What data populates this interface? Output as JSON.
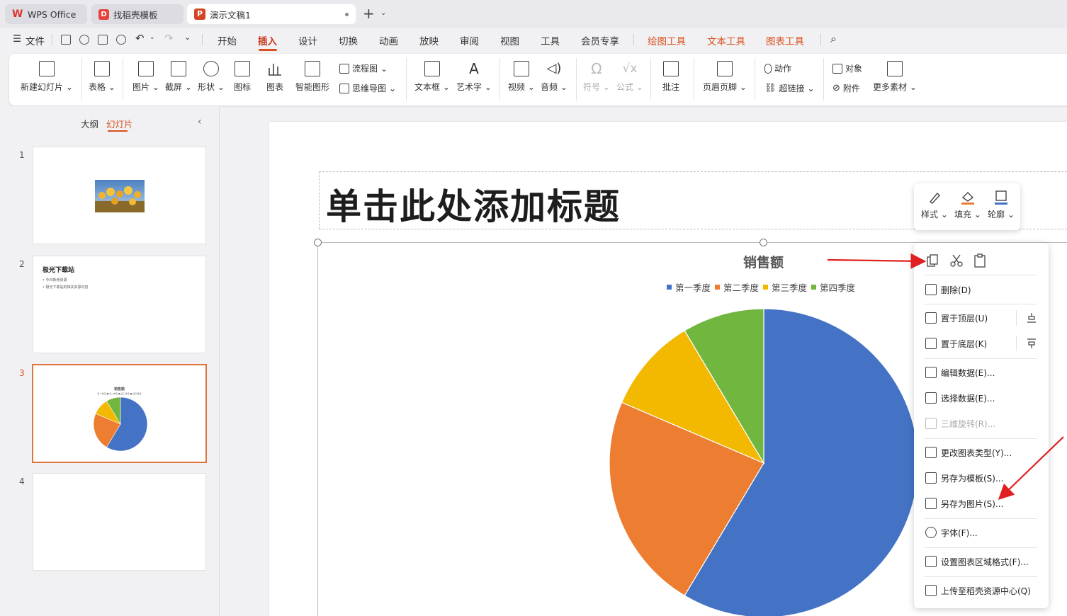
{
  "tabs": [
    {
      "label": "WPS Office",
      "icon": "wps-logo-icon"
    },
    {
      "label": "找稻壳模板",
      "icon": "docer-logo-icon"
    },
    {
      "label": "演示文稿1",
      "icon": "presentation-logo-icon"
    }
  ],
  "menu": {
    "file": "文件",
    "items": [
      "开始",
      "插入",
      "设计",
      "切换",
      "动画",
      "放映",
      "审阅",
      "视图",
      "工具",
      "会员专享"
    ],
    "context_items": [
      "绘图工具",
      "文本工具",
      "图表工具"
    ],
    "active": "插入"
  },
  "ribbon": {
    "new_slide": "新建幻灯片",
    "table": "表格",
    "picture": "图片",
    "screenshot": "截屏",
    "shape": "形状",
    "icon": "图标",
    "chart": "图表",
    "smartart": "智能图形",
    "flowchart": "流程图",
    "mindmap": "思维导图",
    "textbox": "文本框",
    "wordart": "艺术字",
    "video": "视频",
    "audio": "音频",
    "symbol": "符号",
    "formula": "公式",
    "comment": "批注",
    "header_footer": "页眉页脚",
    "action": "动作",
    "hyperlink": "超链接",
    "object": "对象",
    "attachment": "附件",
    "more_assets": "更多素材"
  },
  "left_panel": {
    "tab_outline": "大纲",
    "tab_slides": "幻灯片",
    "slides": [
      {
        "number": "1"
      },
      {
        "number": "2",
        "title": "极光下载站",
        "bullets": [
          "• 今日新增资源",
          "• 极光下载站的相关资源内容"
        ]
      },
      {
        "number": "3",
        "mini_title": "销售额",
        "mini_legend": "第一季度 ■ 第二季度 ■ 第三季度 ■ 第四季度"
      },
      {
        "number": "4"
      }
    ]
  },
  "slide": {
    "title_placeholder": "单击此处添加标题"
  },
  "mini_toolbar": {
    "style": "样式",
    "fill": "填充",
    "outline": "轮廓"
  },
  "context_menu": {
    "delete": "删除(D)",
    "bring_to_front": "置于顶层(U)",
    "send_to_back": "置于底层(K)",
    "edit_data": "编辑数据(E)...",
    "select_data": "选择数据(E)...",
    "rotate_3d": "三维旋转(R)...",
    "change_chart_type": "更改图表类型(Y)...",
    "save_as_template": "另存为模板(S)...",
    "save_as_picture": "另存为图片(S)...",
    "font": "字体(F)...",
    "format_chart_area": "设置图表区域格式(F)...",
    "upload": "上传至稻壳资源中心(Q)"
  },
  "colors": {
    "accent": "#d9501f",
    "series": [
      "#4472c4",
      "#ed7d31",
      "#f2b900",
      "#70b63f"
    ]
  },
  "chart_data": {
    "type": "pie",
    "title": "销售额",
    "categories": [
      "第一季度",
      "第二季度",
      "第三季度",
      "第四季度"
    ],
    "values": [
      8.2,
      3.2,
      1.4,
      1.2
    ],
    "legend_position": "top"
  }
}
